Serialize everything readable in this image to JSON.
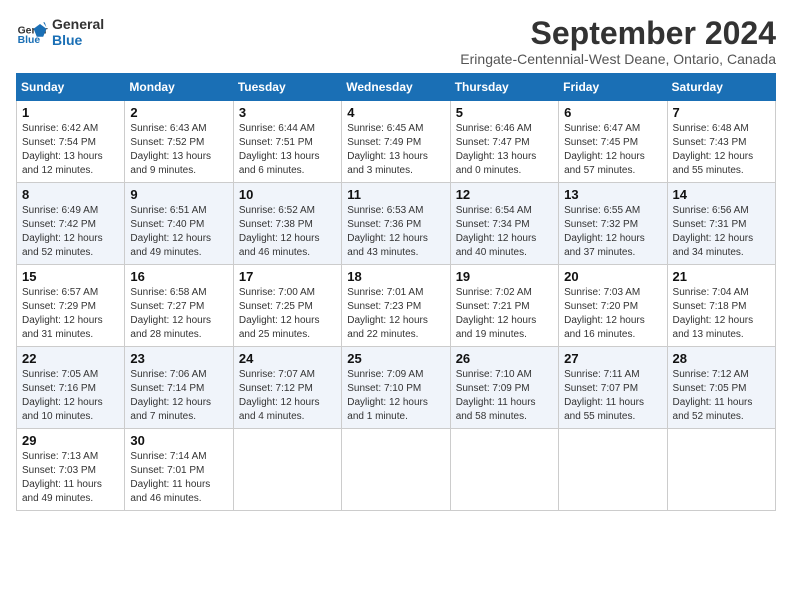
{
  "header": {
    "logo_line1": "General",
    "logo_line2": "Blue",
    "month_title": "September 2024",
    "location": "Eringate-Centennial-West Deane, Ontario, Canada"
  },
  "weekdays": [
    "Sunday",
    "Monday",
    "Tuesday",
    "Wednesday",
    "Thursday",
    "Friday",
    "Saturday"
  ],
  "weeks": [
    [
      {
        "day": "1",
        "sunrise": "6:42 AM",
        "sunset": "7:54 PM",
        "daylight": "13 hours and 12 minutes."
      },
      {
        "day": "2",
        "sunrise": "6:43 AM",
        "sunset": "7:52 PM",
        "daylight": "13 hours and 9 minutes."
      },
      {
        "day": "3",
        "sunrise": "6:44 AM",
        "sunset": "7:51 PM",
        "daylight": "13 hours and 6 minutes."
      },
      {
        "day": "4",
        "sunrise": "6:45 AM",
        "sunset": "7:49 PM",
        "daylight": "13 hours and 3 minutes."
      },
      {
        "day": "5",
        "sunrise": "6:46 AM",
        "sunset": "7:47 PM",
        "daylight": "13 hours and 0 minutes."
      },
      {
        "day": "6",
        "sunrise": "6:47 AM",
        "sunset": "7:45 PM",
        "daylight": "12 hours and 57 minutes."
      },
      {
        "day": "7",
        "sunrise": "6:48 AM",
        "sunset": "7:43 PM",
        "daylight": "12 hours and 55 minutes."
      }
    ],
    [
      {
        "day": "8",
        "sunrise": "6:49 AM",
        "sunset": "7:42 PM",
        "daylight": "12 hours and 52 minutes."
      },
      {
        "day": "9",
        "sunrise": "6:51 AM",
        "sunset": "7:40 PM",
        "daylight": "12 hours and 49 minutes."
      },
      {
        "day": "10",
        "sunrise": "6:52 AM",
        "sunset": "7:38 PM",
        "daylight": "12 hours and 46 minutes."
      },
      {
        "day": "11",
        "sunrise": "6:53 AM",
        "sunset": "7:36 PM",
        "daylight": "12 hours and 43 minutes."
      },
      {
        "day": "12",
        "sunrise": "6:54 AM",
        "sunset": "7:34 PM",
        "daylight": "12 hours and 40 minutes."
      },
      {
        "day": "13",
        "sunrise": "6:55 AM",
        "sunset": "7:32 PM",
        "daylight": "12 hours and 37 minutes."
      },
      {
        "day": "14",
        "sunrise": "6:56 AM",
        "sunset": "7:31 PM",
        "daylight": "12 hours and 34 minutes."
      }
    ],
    [
      {
        "day": "15",
        "sunrise": "6:57 AM",
        "sunset": "7:29 PM",
        "daylight": "12 hours and 31 minutes."
      },
      {
        "day": "16",
        "sunrise": "6:58 AM",
        "sunset": "7:27 PM",
        "daylight": "12 hours and 28 minutes."
      },
      {
        "day": "17",
        "sunrise": "7:00 AM",
        "sunset": "7:25 PM",
        "daylight": "12 hours and 25 minutes."
      },
      {
        "day": "18",
        "sunrise": "7:01 AM",
        "sunset": "7:23 PM",
        "daylight": "12 hours and 22 minutes."
      },
      {
        "day": "19",
        "sunrise": "7:02 AM",
        "sunset": "7:21 PM",
        "daylight": "12 hours and 19 minutes."
      },
      {
        "day": "20",
        "sunrise": "7:03 AM",
        "sunset": "7:20 PM",
        "daylight": "12 hours and 16 minutes."
      },
      {
        "day": "21",
        "sunrise": "7:04 AM",
        "sunset": "7:18 PM",
        "daylight": "12 hours and 13 minutes."
      }
    ],
    [
      {
        "day": "22",
        "sunrise": "7:05 AM",
        "sunset": "7:16 PM",
        "daylight": "12 hours and 10 minutes."
      },
      {
        "day": "23",
        "sunrise": "7:06 AM",
        "sunset": "7:14 PM",
        "daylight": "12 hours and 7 minutes."
      },
      {
        "day": "24",
        "sunrise": "7:07 AM",
        "sunset": "7:12 PM",
        "daylight": "12 hours and 4 minutes."
      },
      {
        "day": "25",
        "sunrise": "7:09 AM",
        "sunset": "7:10 PM",
        "daylight": "12 hours and 1 minute."
      },
      {
        "day": "26",
        "sunrise": "7:10 AM",
        "sunset": "7:09 PM",
        "daylight": "11 hours and 58 minutes."
      },
      {
        "day": "27",
        "sunrise": "7:11 AM",
        "sunset": "7:07 PM",
        "daylight": "11 hours and 55 minutes."
      },
      {
        "day": "28",
        "sunrise": "7:12 AM",
        "sunset": "7:05 PM",
        "daylight": "11 hours and 52 minutes."
      }
    ],
    [
      {
        "day": "29",
        "sunrise": "7:13 AM",
        "sunset": "7:03 PM",
        "daylight": "11 hours and 49 minutes."
      },
      {
        "day": "30",
        "sunrise": "7:14 AM",
        "sunset": "7:01 PM",
        "daylight": "11 hours and 46 minutes."
      },
      null,
      null,
      null,
      null,
      null
    ]
  ]
}
